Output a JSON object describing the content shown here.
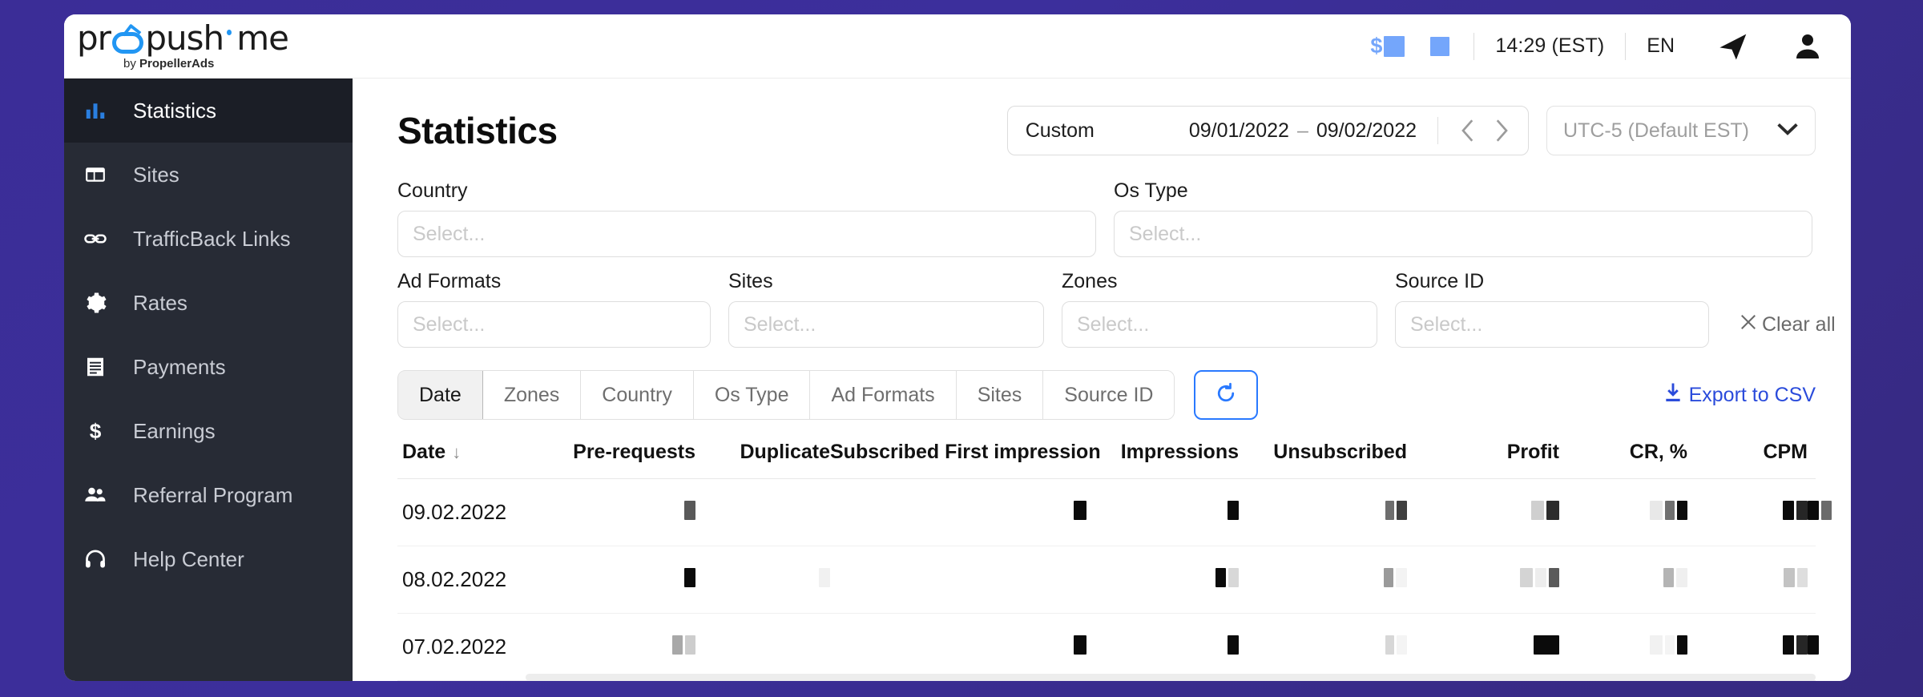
{
  "brand": {
    "logo_pro": "pr",
    "logo_push": "push",
    "logo_me": "me",
    "tagline_prefix": "by ",
    "tagline_bold": "PropellerAds"
  },
  "topbar": {
    "balance_icon": "dollar-icon",
    "balance_value_redacted": "",
    "secondary_value_redacted": "",
    "time": "14:29 (EST)",
    "language": "EN",
    "telegram_icon": "telegram-send-icon",
    "account_icon": "user-account-icon"
  },
  "sidebar": {
    "items": [
      {
        "label": "Statistics",
        "icon": "bar-chart-icon",
        "active": true
      },
      {
        "label": "Sites",
        "icon": "layout-icon",
        "active": false
      },
      {
        "label": "TrafficBack Links",
        "icon": "link-icon",
        "active": false
      },
      {
        "label": "Rates",
        "icon": "gear-icon",
        "active": false
      },
      {
        "label": "Payments",
        "icon": "receipt-icon",
        "active": false
      },
      {
        "label": "Earnings",
        "icon": "dollar-icon",
        "active": false
      },
      {
        "label": "Referral Program",
        "icon": "people-icon",
        "active": false
      },
      {
        "label": "Help Center",
        "icon": "headset-icon",
        "active": false
      }
    ]
  },
  "page": {
    "title": "Statistics"
  },
  "daterange": {
    "mode_label": "Custom",
    "start": "09/01/2022",
    "dash": "–",
    "end": "09/02/2022",
    "prev_icon": "chevron-left-icon",
    "next_icon": "chevron-right-icon"
  },
  "timezone": {
    "value": "UTC-5 (Default EST)",
    "caret_icon": "chevron-down-icon"
  },
  "filters": {
    "placeholder": "Select...",
    "row1": [
      {
        "label": "Country",
        "value": "",
        "key": "country"
      },
      {
        "label": "Os Type",
        "value": "",
        "key": "ostype"
      }
    ],
    "row2": [
      {
        "label": "Ad Formats",
        "value": "",
        "key": "adformats"
      },
      {
        "label": "Sites",
        "value": "",
        "key": "sites"
      },
      {
        "label": "Zones",
        "value": "",
        "key": "zones"
      },
      {
        "label": "Source ID",
        "value": "",
        "key": "sourceid"
      }
    ],
    "clear_all_label": "Clear all",
    "clear_all_icon": "close-x-icon"
  },
  "groupby_tabs": {
    "items": [
      {
        "label": "Date",
        "active": true
      },
      {
        "label": "Zones",
        "active": false
      },
      {
        "label": "Country",
        "active": false
      },
      {
        "label": "Os Type",
        "active": false
      },
      {
        "label": "Ad Formats",
        "active": false
      },
      {
        "label": "Sites",
        "active": false
      },
      {
        "label": "Source ID",
        "active": false
      }
    ],
    "refresh_icon": "refresh-icon"
  },
  "export": {
    "label": "Export to CSV",
    "icon": "download-icon"
  },
  "table": {
    "sort_column": "Date",
    "sort_direction_icon": "arrow-down-icon",
    "columns": [
      "Date",
      "Pre-requests",
      "Duplicate",
      "Subscribed First impression",
      "Impressions",
      "Unsubscribed",
      "Profit",
      "CR, %",
      "CPM"
    ],
    "rows": [
      {
        "date": "09.02.2022",
        "cells": [
          [
            {
              "w": 14,
              "c": "#595959"
            }
          ],
          [],
          [
            {
              "w": 16,
              "c": "#0b0b0b"
            }
          ],
          [
            {
              "w": 14,
              "c": "#0b0b0b"
            }
          ],
          [
            {
              "w": 11,
              "c": "#6e6e6e"
            },
            {
              "w": 13,
              "c": "#3f3f3f"
            }
          ],
          [
            {
              "w": 16,
              "c": "#cfcfcf"
            },
            {
              "w": 16,
              "c": "#2c2c2c"
            }
          ],
          [
            {
              "w": 16,
              "c": "#e8e8e8"
            },
            {
              "w": 12,
              "c": "#707070"
            },
            {
              "w": 13,
              "c": "#0b0b0b"
            }
          ],
          [
            {
              "w": 14,
              "c": "#0b0b0b"
            },
            {
              "w": 14,
              "c": "#262626"
            }
          ],
          [
            {
              "w": 14,
              "c": "#0b0b0b"
            },
            {
              "w": 13,
              "c": "#6b6b6b"
            }
          ]
        ]
      },
      {
        "date": "08.02.2022",
        "cells": [
          [
            {
              "w": 14,
              "c": "#0b0b0b"
            }
          ],
          [
            {
              "w": 14,
              "c": "#f1f1f1"
            }
          ],
          [],
          [
            {
              "w": 13,
              "c": "#0b0b0b"
            },
            {
              "w": 13,
              "c": "#d8d8d8"
            }
          ],
          [
            {
              "w": 12,
              "c": "#9a9a9a"
            },
            {
              "w": 14,
              "c": "#f3f3f3"
            }
          ],
          [
            {
              "w": 16,
              "c": "#d4d4d4"
            },
            {
              "w": 14,
              "c": "#ededed"
            },
            {
              "w": 13,
              "c": "#5a5a5a"
            }
          ],
          [
            {
              "w": 13,
              "c": "#b4b4b4"
            },
            {
              "w": 14,
              "c": "#efefef"
            }
          ],
          [
            {
              "w": 14,
              "c": "#c3c3c3"
            },
            {
              "w": 13,
              "c": "#dedede"
            }
          ],
          []
        ]
      },
      {
        "date": "07.02.2022",
        "cells": [
          [
            {
              "w": 13,
              "c": "#a8a8a8"
            },
            {
              "w": 13,
              "c": "#cdcdcd"
            }
          ],
          [],
          [
            {
              "w": 16,
              "c": "#0b0b0b"
            }
          ],
          [
            {
              "w": 14,
              "c": "#0b0b0b"
            }
          ],
          [
            {
              "w": 11,
              "c": "#d7d7d7"
            },
            {
              "w": 13,
              "c": "#f4f4f4"
            }
          ],
          [
            {
              "w": 32,
              "c": "#0b0b0b"
            }
          ],
          [
            {
              "w": 16,
              "c": "#f1f1f1"
            },
            {
              "w": 12,
              "c": "#f4f4f4"
            },
            {
              "w": 13,
              "c": "#0b0b0b"
            }
          ],
          [
            {
              "w": 14,
              "c": "#0b0b0b"
            },
            {
              "w": 14,
              "c": "#262626"
            }
          ],
          [
            {
              "w": 14,
              "c": "#0b0b0b"
            }
          ]
        ]
      }
    ]
  }
}
